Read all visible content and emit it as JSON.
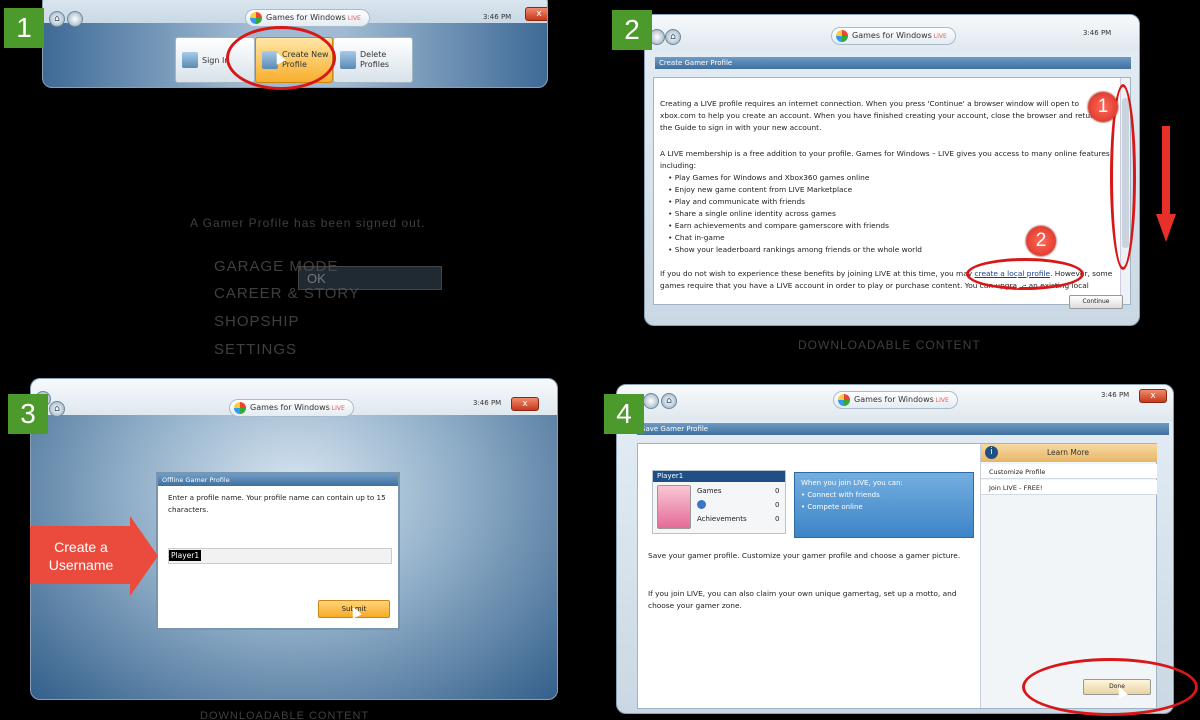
{
  "steps": [
    "1",
    "2",
    "3",
    "4"
  ],
  "common": {
    "app_title": "Games for Windows",
    "live": "LIVE",
    "time": "3:46 PM",
    "close": "x",
    "home": "⌂"
  },
  "p1": {
    "signin": "Sign In",
    "create": "Create New Profile",
    "delete": "Delete Profiles",
    "bg_text": "A Gamer Profile has been signed out.",
    "bg_ok": "OK",
    "bg_menu": [
      "GARAGE MODE",
      "CAREER & STORY",
      "SHOPSHIP",
      "SETTINGS"
    ]
  },
  "p2": {
    "header": "Create Gamer Profile",
    "para1": "Creating a LIVE profile requires an internet connection. When you press 'Continue' a browser window will open to xbox.com to help you create an account. When you have finished creating your account, close the browser and return to the Guide to sign in with your new account.",
    "para2": "A LIVE membership is a free addition to your profile. Games for Windows – LIVE gives you access to many online features, including:",
    "bullets": [
      "Play Games for Windows and Xbox360 games online",
      "Enjoy new game content from LIVE Marketplace",
      "Play and communicate with friends",
      "Share a single online identity across games",
      "Earn achievements and compare gamerscore with friends",
      "Chat in-game",
      "Show your leaderboard rankings among friends or the whole world"
    ],
    "para3_a": "If you do not wish to experience these benefits by joining LIVE at this time, you may ",
    "para3_link": "create a local profile",
    "para3_b": ". However, some games require that you have a LIVE account in order to play or purchase content. You can upgrade an existing local",
    "continue": "Continue",
    "badge1": "1",
    "badge2": "2",
    "bg_text": "DOWNLOADABLE CONTENT"
  },
  "p3": {
    "dialog_title": "Offline Gamer Profile",
    "instruction": "Enter a profile name. Your profile name can contain up to 15 characters.",
    "input_value": "Player1",
    "submit": "Submit",
    "callout": "Create a Username",
    "bg_text": "DOWNLOADABLE CONTENT"
  },
  "p4": {
    "header": "Save Gamer Profile",
    "player": "Player1",
    "games_label": "Games",
    "games_value": "0",
    "score_value": "0",
    "achievements_label": "Achievements",
    "achievements_value": "0",
    "join_title": "When you join LIVE, you can:",
    "join_items": [
      "• Connect with friends",
      "• Compete online"
    ],
    "learn_more": "Learn More",
    "side_items": [
      "Customize Profile",
      "Join LIVE - FREE!"
    ],
    "para1": "Save your gamer profile.  Customize your gamer profile and choose a gamer picture.",
    "para2": "If you join LIVE, you can also claim your own unique gamertag, set up a motto, and choose your gamer zone.",
    "done": "Done"
  },
  "colors": {
    "step_green": "#4d9a2c",
    "annotation_red": "#d81818",
    "header_blue": "#3f6f9d",
    "button_orange": "#f7a928"
  }
}
